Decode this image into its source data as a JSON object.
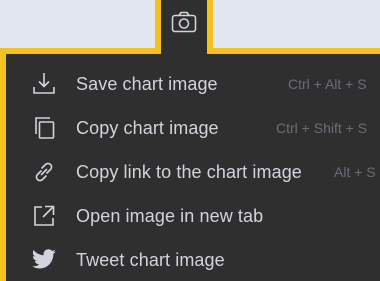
{
  "camera_button": {
    "icon": "camera-icon"
  },
  "menu": {
    "items": [
      {
        "label": "Save chart image",
        "shortcut": "Ctrl + Alt + S",
        "icon": "download-icon"
      },
      {
        "label": "Copy chart image",
        "shortcut": "Ctrl + Shift + S",
        "icon": "copy-icon"
      },
      {
        "label": "Copy link to the chart image",
        "shortcut": "Alt + S",
        "icon": "link-icon"
      },
      {
        "label": "Open image in new tab",
        "shortcut": "",
        "icon": "external-link-icon"
      },
      {
        "label": "Tweet chart image",
        "shortcut": "",
        "icon": "twitter-icon"
      }
    ]
  },
  "colors": {
    "accent": "#f2c11d",
    "menu_bg": "#2f2f30",
    "text": "#d1d4dc",
    "shortcut_text": "#6a6d78",
    "page_bg": "#e1e6f0"
  }
}
